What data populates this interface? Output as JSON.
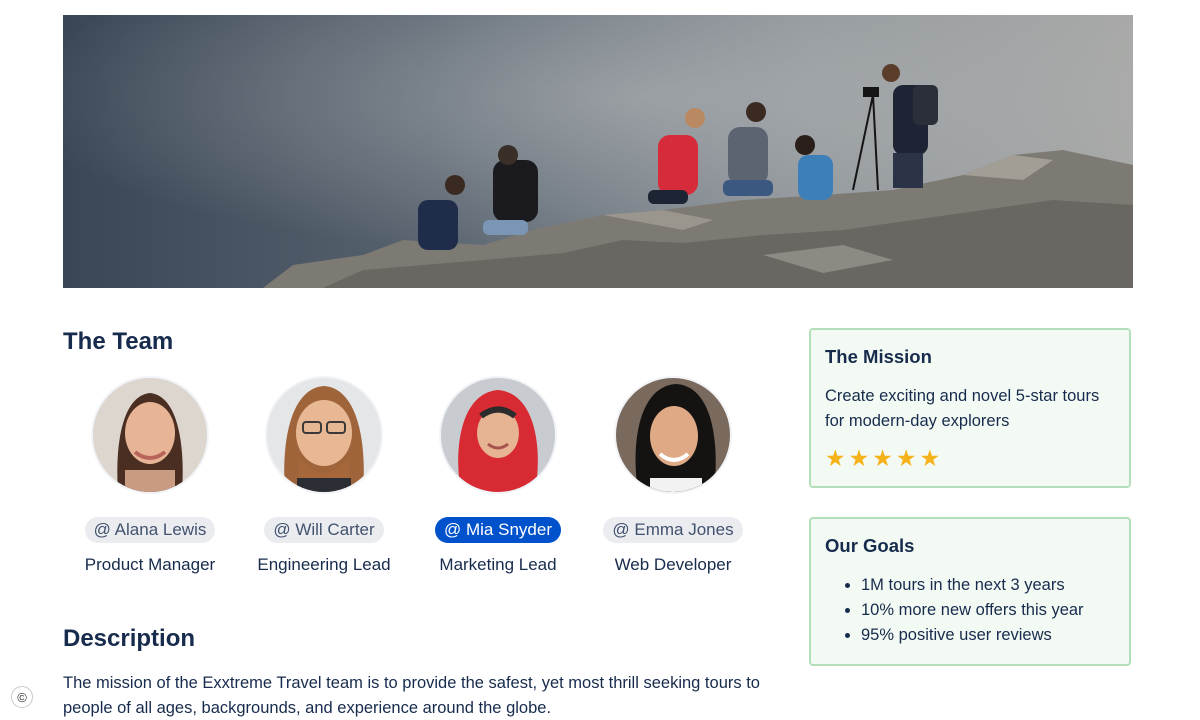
{
  "hero": {
    "image": "hikers-on-rocky-cliff-photo"
  },
  "team": {
    "title": "The Team",
    "members": [
      {
        "handle": "@ Alana Lewis",
        "role": "Product Manager",
        "selected": false
      },
      {
        "handle": "@ Will Carter",
        "role": "Engineering Lead",
        "selected": false
      },
      {
        "handle": "@ Mia Snyder",
        "role": "Marketing Lead",
        "selected": true
      },
      {
        "handle": "@ Emma Jones",
        "role": "Web Developer",
        "selected": false
      }
    ]
  },
  "description": {
    "title": "Description",
    "text": "The mission of the Exxtreme Travel team is to provide the safest, yet most thrill seeking tours to people of all ages, backgrounds, and experience around the globe."
  },
  "mission": {
    "title": "The Mission",
    "text": "Create exciting and novel 5-star tours for modern-day explorers",
    "rating": 5,
    "star_color": "#f5b21a"
  },
  "goals": {
    "title": "Our Goals",
    "items": [
      "1M tours in the next 3 years",
      "10% more new offers this year",
      "95% positive user reviews"
    ]
  },
  "footer": {
    "copyright_icon": "copyright-icon"
  },
  "colors": {
    "accent": "#0052cc",
    "panel_bg": "#f3faf4",
    "panel_border": "#b3dfb8",
    "mention_bg": "#ebecf0",
    "text": "#172b4d"
  }
}
